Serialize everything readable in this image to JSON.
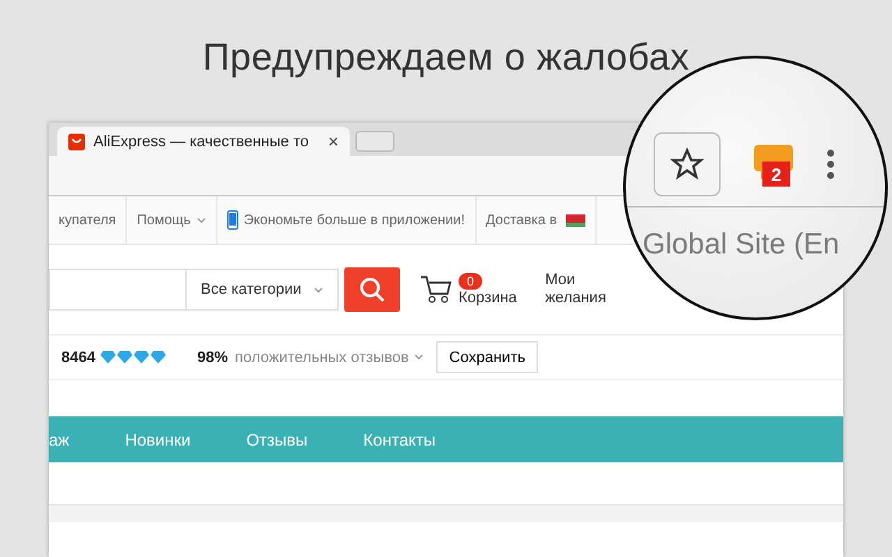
{
  "headline": "Предупреждаем о жалобах",
  "browser_tab": {
    "title": "AliExpress — качественные то",
    "close": "×"
  },
  "top_nav": [
    {
      "label": "купателя",
      "dropdown": false,
      "kind": "text"
    },
    {
      "label": "Помощь",
      "dropdown": true,
      "kind": "text"
    },
    {
      "label": "Экономьте больше в приложении!",
      "dropdown": false,
      "kind": "phone"
    },
    {
      "label": "Доставка в",
      "dropdown": false,
      "kind": "flag"
    }
  ],
  "search": {
    "category": "Все категории"
  },
  "cart": {
    "count": "0",
    "label": "Корзина"
  },
  "wishlist": {
    "label": "Мои желания"
  },
  "store": {
    "score": "8464",
    "stars": 4,
    "percent": "98%",
    "feedback": "положительных отзывов",
    "save": "Сохранить"
  },
  "store_nav": [
    {
      "label": "аж"
    },
    {
      "label": "Новинки"
    },
    {
      "label": "Отзывы"
    },
    {
      "label": "Контакты"
    }
  ],
  "magnifier": {
    "badge": "2",
    "site_text": "Global Site (En"
  }
}
